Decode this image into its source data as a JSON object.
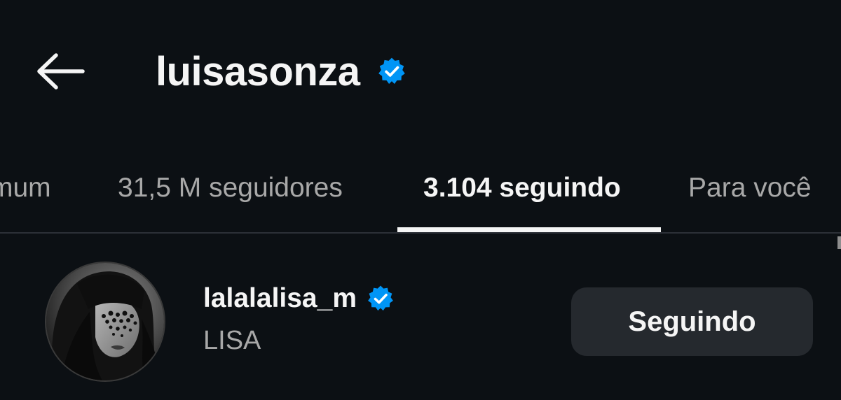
{
  "header": {
    "title": "luisasonza",
    "verified": true,
    "back_icon": "arrow-left-icon"
  },
  "tabs": [
    {
      "label": "mum",
      "active": false
    },
    {
      "label": "31,5 M seguidores",
      "active": false
    },
    {
      "label": "3.104 seguindo",
      "active": true
    },
    {
      "label": "Para você",
      "active": false
    }
  ],
  "list": [
    {
      "username": "lalalalisa_m",
      "verified": true,
      "full_name": "LISA",
      "button_label": "Seguindo",
      "avatar_icon": "profile-photo"
    }
  ],
  "colors": {
    "background": "#0c1014",
    "text_primary": "#f5f5f5",
    "text_secondary": "#a8a8a8",
    "verified_blue": "#0095f6",
    "button_bg": "#25292e",
    "divider": "#2c3037"
  }
}
